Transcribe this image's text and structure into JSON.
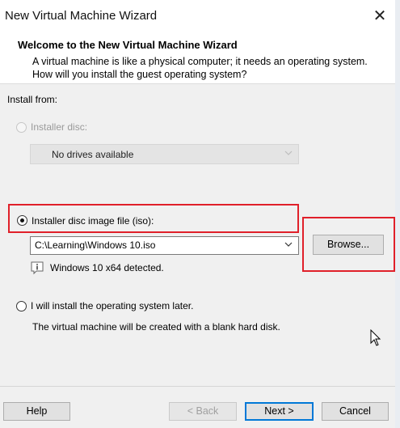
{
  "window": {
    "title": "New Virtual Machine Wizard",
    "close_glyph": "✕"
  },
  "header": {
    "title": "Welcome to the New Virtual Machine Wizard",
    "description": "A virtual machine is like a physical computer; it needs an operating system. How will you install the guest operating system?"
  },
  "install_from_label": "Install from:",
  "options": {
    "installer_disc": {
      "label": "Installer disc:",
      "selected": false,
      "enabled": false,
      "dropdown_value": "No drives available"
    },
    "iso_file": {
      "label": "Installer disc image file (iso):",
      "selected": true,
      "enabled": true,
      "path_value": "C:\\Learning\\Windows 10.iso",
      "browse_label": "Browse...",
      "detected_text": "Windows 10 x64 detected."
    },
    "install_later": {
      "label": "I will install the operating system later.",
      "selected": false,
      "enabled": true,
      "description": "The virtual machine will be created with a blank hard disk."
    }
  },
  "footer": {
    "help_label": "Help",
    "back_label": "< Back",
    "next_label": "Next >",
    "cancel_label": "Cancel"
  },
  "icons": {
    "close": "close-icon",
    "chevron": "chevron-down-icon",
    "info": "info-icon",
    "cursor": "mouse-cursor-icon"
  },
  "colors": {
    "highlight_box": "#e0202a",
    "default_button_border": "#0078d7"
  }
}
